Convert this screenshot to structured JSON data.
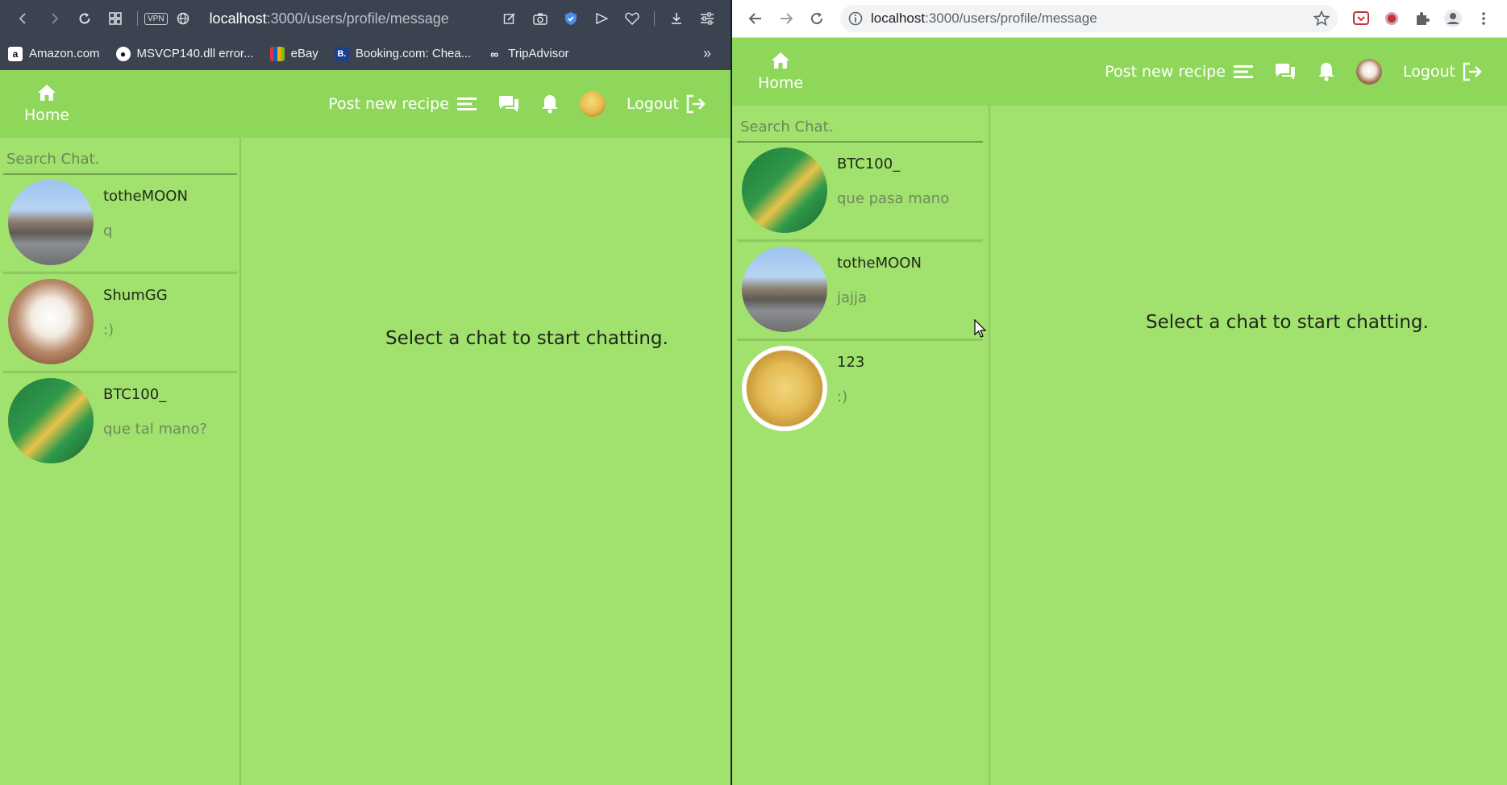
{
  "left_browser": {
    "url_host": "localhost",
    "url_path": ":3000/users/profile/message",
    "vpn_label": "VPN",
    "bookmarks": [
      {
        "label": "Amazon.com",
        "icon": "amazon-icon"
      },
      {
        "label": "MSVCP140.dll error...",
        "icon": "github-icon"
      },
      {
        "label": "eBay",
        "icon": "ebay-icon"
      },
      {
        "label": "Booking.com: Chea...",
        "icon": "booking-icon"
      },
      {
        "label": "TripAdvisor",
        "icon": "tripadvisor-icon"
      }
    ]
  },
  "right_browser": {
    "url_host": "localhost",
    "url_path": ":3000/users/profile/message"
  },
  "left_app": {
    "nav": {
      "home_label": "Home",
      "post_recipe_label": "Post new recipe",
      "logout_label": "Logout"
    },
    "search": {
      "placeholder": "Search Chat."
    },
    "chats": [
      {
        "name": "totheMOON",
        "message": "q",
        "avatar": "street-photo"
      },
      {
        "name": "ShumGG",
        "message": ":)",
        "avatar": "cook-logo"
      },
      {
        "name": "BTC100_",
        "message": "que tal mano?",
        "avatar": "pretz-snack"
      }
    ],
    "empty_state": "Select a chat to start chatting."
  },
  "right_app": {
    "nav": {
      "home_label": "Home",
      "post_recipe_label": "Post new recipe",
      "logout_label": "Logout"
    },
    "search": {
      "placeholder": "Search Chat."
    },
    "chats": [
      {
        "name": "BTC100_",
        "message": "que pasa mano",
        "avatar": "pretz-snack"
      },
      {
        "name": "totheMOON",
        "message": "jajja",
        "avatar": "street-photo"
      },
      {
        "name": "123",
        "message": ":)",
        "avatar": "potato"
      }
    ],
    "empty_state": "Select a chat to start chatting."
  },
  "colors": {
    "nav_bg": "#8fd75a",
    "page_bg": "#a1e16d",
    "opera_chrome": "#3b4350"
  }
}
